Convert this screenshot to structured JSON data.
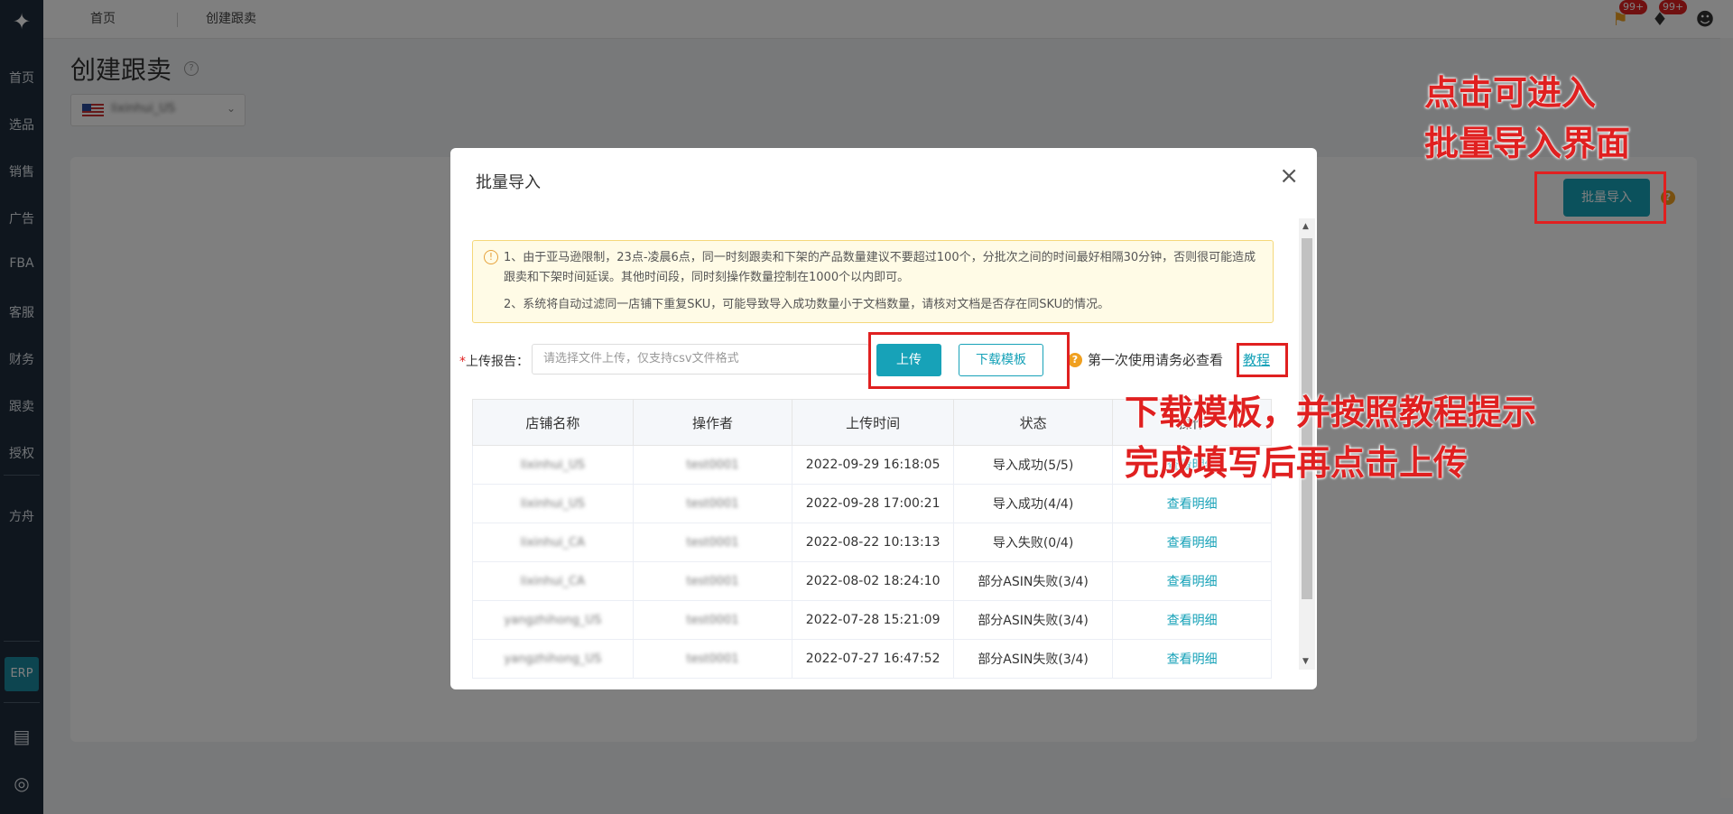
{
  "sidebar": {
    "logo": "logo-icon",
    "items": [
      "首页",
      "选品",
      "销售",
      "广告",
      "FBA",
      "客服",
      "财务",
      "跟卖",
      "授权",
      "方舟"
    ],
    "erp_label": "ERP"
  },
  "topbar": {
    "tabs": [
      "首页",
      "创建跟卖"
    ],
    "badges": [
      "99+",
      "99+"
    ]
  },
  "page": {
    "title": "创建跟卖",
    "store": "lixinhui_US",
    "batch_button": "批量导入"
  },
  "modal": {
    "title": "批量导入",
    "alert_lines": [
      "1、由于亚马逊限制，23点-凌晨6点，同一时刻跟卖和下架的产品数量建议不要超过100个，分批次之间的时间最好相隔30分钟，否则很可能造成跟卖和下架时间延误。其他时间段，同时刻操作数量控制在1000个以内即可。",
      "2、系统将自动过滤同一店铺下重复SKU，可能导致导入成功数量小于文档数量，请核对文档是否存在同SKU的情况。"
    ],
    "upload_label": "上传报告：",
    "upload_required": "*",
    "upload_placeholder": "请选择文件上传，仅支持csv文件格式",
    "upload_button": "上传",
    "template_button": "下载模板",
    "hint_text": "第一次使用请务必查看",
    "hint_link": "教程",
    "table": {
      "headers": [
        "店铺名称",
        "操作者",
        "上传时间",
        "状态",
        "操作"
      ],
      "rows": [
        {
          "store": "lixinhui_US",
          "operator": "test0001",
          "time": "2022-09-29 16:18:05",
          "status": "导入成功(5/5)",
          "action": "查看明细"
        },
        {
          "store": "lixinhui_US",
          "operator": "test0001",
          "time": "2022-09-28 17:00:21",
          "status": "导入成功(4/4)",
          "action": "查看明细"
        },
        {
          "store": "lixinhui_CA",
          "operator": "test0001",
          "time": "2022-08-22 10:13:13",
          "status": "导入失败(0/4)",
          "action": "查看明细"
        },
        {
          "store": "lixinhui_CA",
          "operator": "test0001",
          "time": "2022-08-02 18:24:10",
          "status": "部分ASIN失败(3/4)",
          "action": "查看明细"
        },
        {
          "store": "yangzhihong_US",
          "operator": "test0001",
          "time": "2022-07-28 15:21:09",
          "status": "部分ASIN失败(3/4)",
          "action": "查看明细"
        },
        {
          "store": "yangzhihong_US",
          "operator": "test0001",
          "time": "2022-07-27 16:47:52",
          "status": "部分ASIN失败(3/4)",
          "action": "查看明细"
        }
      ]
    }
  },
  "annotations": {
    "top_line1": "点击可进入",
    "top_line2": "批量导入界面",
    "mid_line1": "下载模板，并按照教程提示",
    "mid_line2": "完成填写后再点击上传"
  },
  "colors": {
    "accent": "#17a2b8",
    "sidebar": "#1f2d3d",
    "annotation": "#e02020"
  }
}
